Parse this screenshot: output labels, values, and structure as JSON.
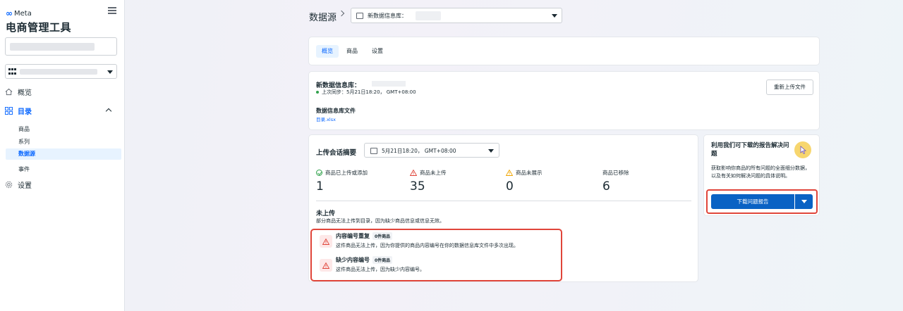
{
  "sidebar": {
    "brand": "Meta",
    "brand_mark": "∞",
    "app_title": "电商管理工具",
    "nav": {
      "overview": "概览",
      "catalog": "目录",
      "products": "商品",
      "sets": "系列",
      "data_sources": "数据源",
      "events": "事件",
      "settings": "设置"
    }
  },
  "header": {
    "breadcrumb": "数据源",
    "data_source_select": "新数据信息库："
  },
  "tabs": [
    "概览",
    "商品",
    "设置"
  ],
  "data_feed": {
    "title": "新数据信息库：",
    "last_sync": "上次同步：5月21日18:20， GMT+08:00",
    "reupload_label": "重新上传文件",
    "file_heading": "数据信息库文件",
    "file_name": "目录.xlsx"
  },
  "upload_summary": {
    "title": "上传会话摘要",
    "date_value": "5月21日18:20， GMT+08:00",
    "stats": [
      {
        "label": "商品已上传或添加",
        "value": "1"
      },
      {
        "label": "商品未上传",
        "value": "35"
      },
      {
        "label": "商品未展示",
        "value": "0"
      },
      {
        "label": "商品已移除",
        "value": "6"
      }
    ],
    "not_uploaded_title": "未上传",
    "not_uploaded_desc": "部分商品无法上传到目录，因为缺少商品信息或信息无效。",
    "issues": [
      {
        "title": "内容编号重复",
        "badge": "0件商品",
        "desc": "这件商品无法上传，因为你提供的商品内容编号在你的数据信息库文件中多次出现。"
      },
      {
        "title": "缺少内容编号",
        "badge": "0件商品",
        "desc": "这件商品无法上传，因为缺少内容编号。"
      }
    ]
  },
  "report": {
    "title": "利用我们可下载的报告解决问题",
    "desc": "获取影响你商品的所有问题的全面细分数据，以及有关如何解决问题的具体说明。",
    "download_label": "下载问题报告"
  },
  "colors": {
    "accent": "#0866ff",
    "button": "#0a62c4",
    "error": "#e0453a",
    "warning": "#f0a500",
    "success": "#31a24c"
  }
}
